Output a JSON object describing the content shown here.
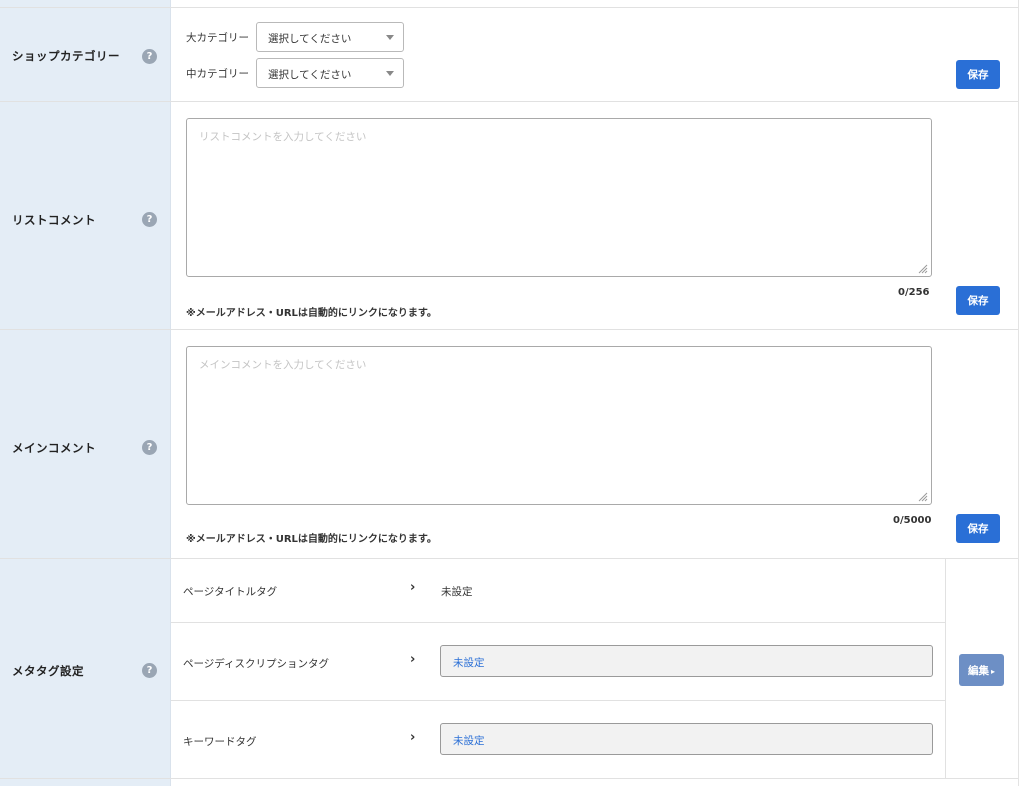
{
  "shop_category": {
    "label": "ショップカテゴリー",
    "help": "?",
    "major_label": "大カテゴリー",
    "major_value": "選択してください",
    "middle_label": "中カテゴリー",
    "middle_value": "選択してください",
    "save_label": "保存"
  },
  "list_comment": {
    "label": "リストコメント",
    "help": "?",
    "placeholder": "リストコメントを入力してください",
    "note": "※メールアドレス・URLは自動的にリンクになります。",
    "counter": "0/256",
    "save_label": "保存"
  },
  "main_comment": {
    "label": "メインコメント",
    "help": "?",
    "placeholder": "メインコメントを入力してください",
    "note": "※メールアドレス・URLは自動的にリンクになります。",
    "counter": "0/5000",
    "save_label": "保存"
  },
  "meta_tags": {
    "label": "メタタグ設定",
    "help": "?",
    "chevron": "›",
    "title_tag_label": "ページタイトルタグ",
    "title_tag_value": "未設定",
    "description_tag_label": "ページディスクリプションタグ",
    "description_tag_value": "未設定",
    "keyword_tag_label": "キーワードタグ",
    "keyword_tag_value": "未設定",
    "edit_label": "編集",
    "edit_caret": "▸"
  },
  "colors": {
    "label_bg": "#e4edf6",
    "primary_button": "#2a6fd6",
    "edit_button": "#6d8fc5",
    "link_text": "#2a6fd6"
  }
}
